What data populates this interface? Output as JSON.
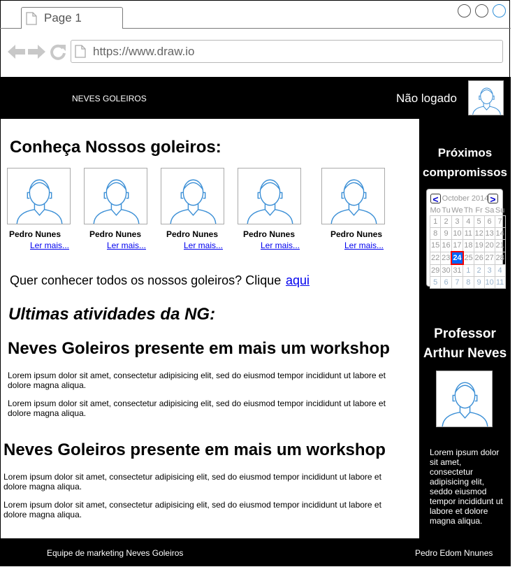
{
  "browser": {
    "tab_label": "Page 1",
    "url": "https://www.draw.io"
  },
  "header": {
    "brand": "NEVES GOLEIROS",
    "login_status": "Não logado"
  },
  "main": {
    "title": "Conheça Nossos goleiros:",
    "goalkeepers": [
      {
        "name": "Pedro Nunes",
        "link": "Ler mais..."
      },
      {
        "name": "Pedro Nunes",
        "link": "Ler mais..."
      },
      {
        "name": "Pedro Nunes",
        "link": "Ler mais..."
      },
      {
        "name": "Pedro Nunes",
        "link": "Ler mais..."
      },
      {
        "name": "Pedro Nunes",
        "link": "Ler mais..."
      }
    ],
    "cta_text": "Quer conhecer todos os nossos goleiros? Clique",
    "cta_link": "aqui",
    "activities_title": "Ultimas atividades da NG:",
    "articles": [
      {
        "title": "Neves Goleiros presente em mais um workshop",
        "paragraphs": [
          "Lorem ipsum dolor sit amet, consectetur adipisicing elit, sed do eiusmod tempor incididunt ut labore et dolore magna aliqua.",
          "Lorem ipsum dolor sit amet, consectetur adipisicing elit, sed do eiusmod tempor incididunt ut labore et dolore magna aliqua."
        ]
      },
      {
        "title": "Neves Goleiros presente em mais um workshop",
        "paragraphs": [
          "Lorem ipsum dolor sit amet, consectetur adipisicing elit, sed do eiusmod tempor incididunt ut labore et dolore magna aliqua.",
          "Lorem ipsum dolor sit amet, consectetur adipisicing elit, sed do eiusmod tempor incididunt ut labore et dolore magna aliqua."
        ]
      }
    ]
  },
  "sidebar": {
    "schedule_title_1": "Próximos",
    "schedule_title_2": "compromissos",
    "calendar": {
      "prev": "<",
      "next": ">",
      "month": "October 2014",
      "weekdays": [
        "Mo",
        "Tu",
        "We",
        "Th",
        "Fr",
        "Sa",
        "Su"
      ],
      "weeks": [
        [
          "1",
          "2",
          "3",
          "4",
          "5",
          "6",
          "7"
        ],
        [
          "8",
          "9",
          "10",
          "11",
          "12",
          "13",
          "14"
        ],
        [
          "15",
          "16",
          "17",
          "18",
          "19",
          "20",
          "21"
        ],
        [
          "22",
          "23",
          "24",
          "25",
          "26",
          "27",
          "28"
        ],
        [
          "29",
          "30",
          "31",
          "1",
          "2",
          "3",
          "4"
        ],
        [
          "5",
          "6",
          "7",
          "8",
          "9",
          "10",
          "11"
        ]
      ],
      "selected_day": "24"
    },
    "professor_title_1": "Professor",
    "professor_title_2": "Arthur Neves",
    "professor_text": "Lorem ipsum dolor sit amet, consectetur adipisicing elit, seddo eiusmod tempor incididunt ut labore et dolore magna aliqua."
  },
  "footer": {
    "left": "Equipe de marketing Neves Goleiros",
    "right": "Pedro Edom Nnunes"
  },
  "colors": {
    "link": "#0000ee",
    "header_bg": "#000000",
    "avatar_stroke": "#3b8fd6",
    "calendar_selected": "#0066ff"
  }
}
